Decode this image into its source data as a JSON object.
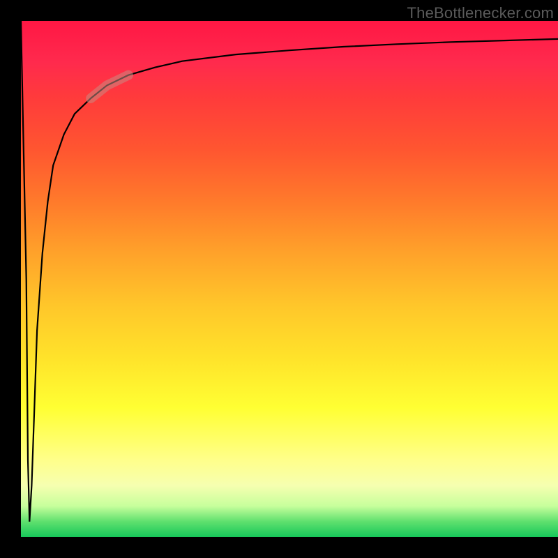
{
  "watermark": {
    "text": "TheBottlenecker.com"
  },
  "chart_data": {
    "type": "line",
    "title": "",
    "xlabel": "",
    "ylabel": "",
    "xlim": [
      0,
      100
    ],
    "ylim": [
      0,
      100
    ],
    "grid": false,
    "legend": false,
    "background_gradient": {
      "direction": "vertical",
      "stops": [
        {
          "pos": 0.0,
          "color": "#ff1744",
          "meaning": "severe bottleneck"
        },
        {
          "pos": 0.5,
          "color": "#ffb726",
          "meaning": "moderate"
        },
        {
          "pos": 0.78,
          "color": "#ffff33",
          "meaning": "slight"
        },
        {
          "pos": 1.0,
          "color": "#16c75a",
          "meaning": "balanced"
        }
      ]
    },
    "series": [
      {
        "name": "bottleneck-curve",
        "x": [
          0,
          1,
          1.3,
          1.6,
          2,
          2.5,
          3,
          4,
          5,
          6,
          8,
          10,
          13,
          16,
          20,
          25,
          30,
          40,
          50,
          60,
          70,
          80,
          90,
          100
        ],
        "y": [
          100,
          50,
          15,
          3,
          10,
          25,
          40,
          55,
          65,
          72,
          78,
          82,
          85,
          87.5,
          89.5,
          91,
          92.2,
          93.5,
          94.3,
          95,
          95.5,
          95.9,
          96.2,
          96.5
        ]
      }
    ],
    "marker": {
      "description": "highlighted pill segment on curve",
      "x_range": [
        13,
        20
      ],
      "color": "#c98a82"
    }
  },
  "colors": {
    "curve_stroke": "#000000",
    "marker_stroke": "#c98a82",
    "watermark": "#5b5b5b",
    "frame": "#000000"
  }
}
